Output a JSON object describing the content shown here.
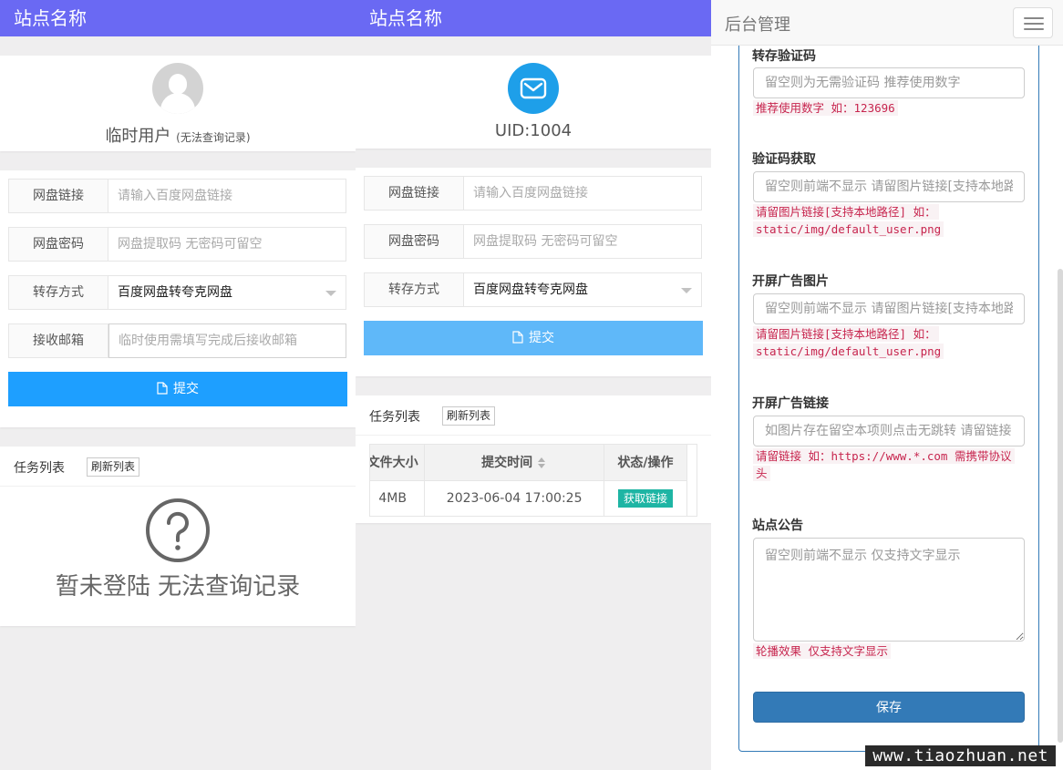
{
  "site_name": "站点名称",
  "guest_view": {
    "user_name": "临时用户",
    "user_note": "(无法查询记录)",
    "form": {
      "link_label": "网盘链接",
      "link_placeholder": "请输入百度网盘链接",
      "pwd_label": "网盘密码",
      "pwd_placeholder": "网盘提取码 无密码可留空",
      "mode_label": "转存方式",
      "mode_value": "百度网盘转夸克网盘",
      "email_label": "接收邮箱",
      "email_placeholder": "临时使用需填写完成后接收邮箱",
      "submit_label": "提交"
    },
    "tasks": {
      "title": "任务列表",
      "refresh_label": "刷新列表",
      "empty_text": "暂未登陆 无法查询记录"
    }
  },
  "user_view": {
    "uid_text": "UID:1004",
    "form": {
      "link_label": "网盘链接",
      "link_placeholder": "请输入百度网盘链接",
      "pwd_label": "网盘密码",
      "pwd_placeholder": "网盘提取码 无密码可留空",
      "mode_label": "转存方式",
      "mode_value": "百度网盘转夸克网盘",
      "submit_label": "提交"
    },
    "tasks": {
      "title": "任务列表",
      "refresh_label": "刷新列表",
      "columns": [
        "文件大小",
        "提交时间",
        "状态/操作"
      ],
      "rows": [
        {
          "size": "4MB",
          "time": "2023-06-04 17:00:25",
          "action": "获取链接"
        }
      ]
    }
  },
  "admin": {
    "title": "后台管理",
    "fields": {
      "captcha_label": "转存验证码",
      "captcha_placeholder": "留空则为无需验证码 推荐使用数字",
      "captcha_help": "推荐使用数字 如：123696",
      "captcha_img_label": "验证码获取",
      "captcha_img_placeholder": "留空则前端不显示 请留图片链接[支持本地路径]",
      "captcha_img_help_1": "请留图片链接[支持本地路径] 如：",
      "captcha_img_help_2": "static/img/default_user.png",
      "splash_img_label": "开屏广告图片",
      "splash_img_placeholder": "留空则前端不显示 请留图片链接[支持本地路径]",
      "splash_img_help_1": "请留图片链接[支持本地路径] 如：",
      "splash_img_help_2": "static/img/default_user.png",
      "splash_link_label": "开屏广告链接",
      "splash_link_placeholder": "如图片存在留空本项则点击无跳转 请留链接",
      "splash_link_help_1": "请留链接 如：https://www.*.com 需携带协议",
      "splash_link_help_2": "头",
      "notice_label": "站点公告",
      "notice_placeholder": "留空则前端不显示 仅支持文字显示",
      "notice_help": "轮播效果 仅支持文字显示"
    },
    "save_label": "保存"
  },
  "watermark": "www.tiaozhuan.net",
  "colors": {
    "topbar": "#6a69f3",
    "submit_guest": "#1e9fff",
    "submit_user": "#5fb8f9",
    "admin_primary": "#337ab7",
    "help_text": "#c7254e",
    "tag": "#1eb5a4"
  }
}
